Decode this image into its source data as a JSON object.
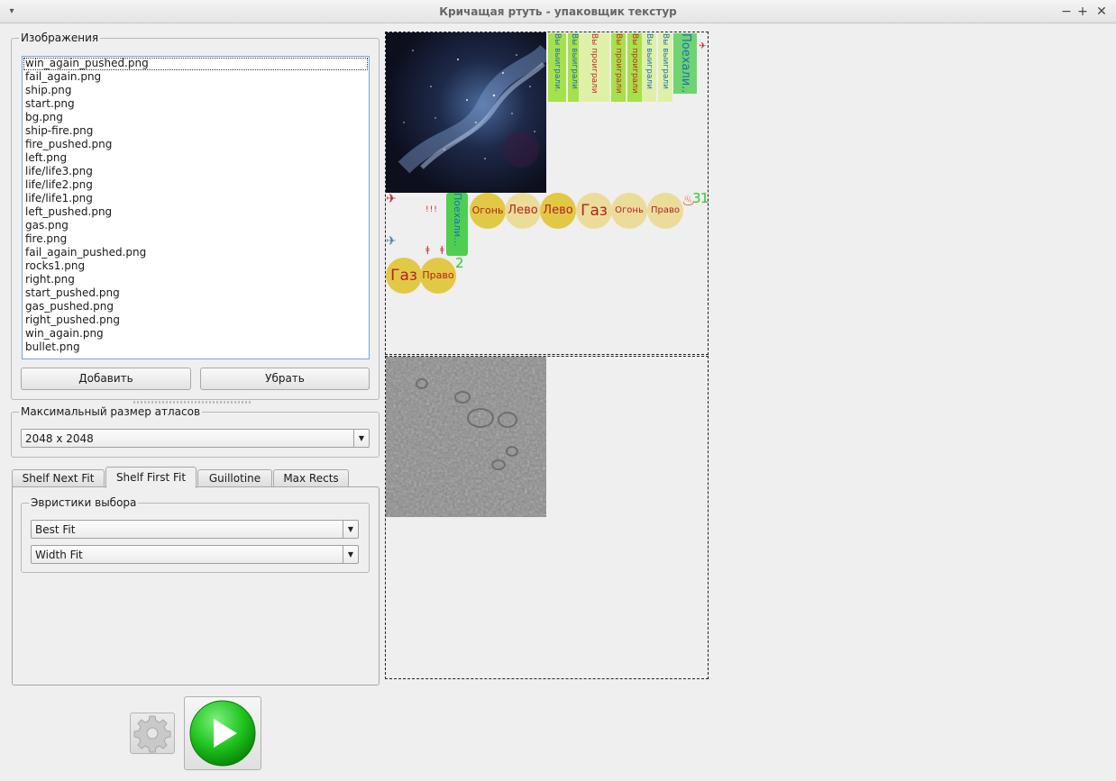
{
  "window": {
    "title": "Кричащая ртуть - упаковщик текстур",
    "menu_glyph": "▾",
    "minimize_glyph": "−",
    "maximize_glyph": "+",
    "close_glyph": "✕"
  },
  "images_group": {
    "title": "Изображения",
    "files": [
      "win_again_pushed.png",
      "fail_again.png",
      "ship.png",
      "start.png",
      "bg.png",
      "ship-fire.png",
      "fire_pushed.png",
      "left.png",
      "life/life3.png",
      "life/life2.png",
      "life/life1.png",
      "left_pushed.png",
      "gas.png",
      "fire.png",
      "fail_again_pushed.png",
      "rocks1.png",
      "right.png",
      "start_pushed.png",
      "gas_pushed.png",
      "right_pushed.png",
      "win_again.png",
      "bullet.png"
    ],
    "add_label": "Добавить",
    "remove_label": "Убрать"
  },
  "atlas_size_group": {
    "title": "Максимальный размер атласов",
    "selected": "2048 x 2048"
  },
  "tabs": [
    {
      "label": "Shelf Next Fit",
      "active": false
    },
    {
      "label": "Shelf First Fit",
      "active": true
    },
    {
      "label": "Guillotine",
      "active": false
    },
    {
      "label": "Max Rects",
      "active": false
    }
  ],
  "heuristics_group": {
    "title": "Эвристики выбора",
    "combo1": "Best Fit",
    "combo2": "Width Fit"
  },
  "bottom": {
    "settings_icon": "gear-icon",
    "run_icon": "play-icon"
  },
  "atlas_preview": {
    "vertical_labels": [
      {
        "text": "Вы выиграли.",
        "color": "#1c6fb8",
        "bg": "#a6e04a"
      },
      {
        "text": "Вы выиграли",
        "color": "#1c6fb8",
        "bg": "#a6e04a"
      },
      {
        "text": "Вы проиграли",
        "color": "#c62828",
        "bg": "#dff0a8"
      },
      {
        "text": "Вы проиграли",
        "color": "#c62828",
        "bg": "#a6e04a"
      },
      {
        "text": "Вы проиграли",
        "color": "#c62828",
        "bg": "#a6e04a"
      },
      {
        "text": "Вы выиграли",
        "color": "#1c6fb8",
        "bg": "#dff0a8"
      },
      {
        "text": "Вы выиграли",
        "color": "#1c6fb8",
        "bg": "#dff0a8"
      }
    ],
    "go_label_top": "Поехали...",
    "go_label_mid": "Поехали...",
    "circles_row1": [
      {
        "text": "Огонь",
        "bg": "#e2c945",
        "size": 11
      },
      {
        "text": "Лево",
        "bg": "#ecdc9a",
        "size": 13
      },
      {
        "text": "Лево",
        "bg": "#e2c945",
        "size": 13
      },
      {
        "text": "Газ",
        "bg": "#ecdc9a",
        "size": 17
      },
      {
        "text": "Огонь",
        "bg": "#ecdc9a",
        "size": 10
      },
      {
        "text": "Право",
        "bg": "#ecdc9a",
        "size": 10
      }
    ],
    "circles_row2": [
      {
        "text": "Газ",
        "bg": "#e2c945",
        "size": 17
      },
      {
        "text": "Право",
        "bg": "#e2c945",
        "size": 11
      }
    ],
    "life_numbers": {
      "three": "3",
      "one": "1",
      "two": "2"
    },
    "ship_glyph": "✈",
    "fire_glyph": "🔥"
  }
}
